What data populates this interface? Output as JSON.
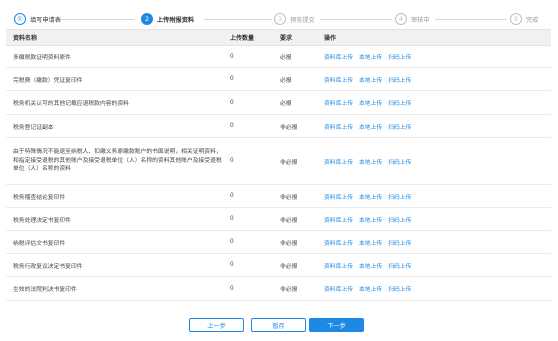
{
  "stepper": {
    "steps": [
      {
        "number": "①",
        "label": "填写申请表",
        "state": "done"
      },
      {
        "number": "2",
        "label": "上传附报资料",
        "state": "active"
      },
      {
        "number": "3",
        "label": "预览提交",
        "state": "todo"
      },
      {
        "number": "4",
        "label": "审核中",
        "state": "todo"
      },
      {
        "number": "5",
        "label": "完成",
        "state": "todo"
      }
    ]
  },
  "table": {
    "headers": {
      "name": "资料名称",
      "count": "上传数量",
      "required": "要求",
      "ops": "操作"
    },
    "rows": [
      {
        "name": "多缴税款证明资料原件",
        "count": "0",
        "required": "必报",
        "ops": [
          "资料库上传",
          "本地上传",
          "扫码上传"
        ]
      },
      {
        "name": "完税费（缴款）凭证复印件",
        "count": "0",
        "required": "必报",
        "ops": [
          "资料库上传",
          "本地上传",
          "扫码上传"
        ]
      },
      {
        "name": "税务机关认可的其他记载应退税款内容的资料",
        "count": "0",
        "required": "必报",
        "ops": [
          "资料库上传",
          "本地上传",
          "扫码上传"
        ]
      },
      {
        "name": "税务登记证副本",
        "count": "0",
        "required": "非必报",
        "ops": [
          "资料库上传",
          "本地上传",
          "扫码上传"
        ]
      },
      {
        "name": "由于特殊情况不能退至纳税人、扣缴义务原缴款账户的书面说明，相关证明资料，和指定接受退税的其他账户及接受退税单位（人）名称的资料其他账户及接受退税单位（人）名称的资料",
        "count": "0",
        "required": "非必报",
        "ops": [
          "资料库上传",
          "本地上传",
          "扫码上传"
        ]
      },
      {
        "name": "税务稽查结论复印件",
        "count": "0",
        "required": "非必报",
        "ops": [
          "资料库上传",
          "本地上传",
          "扫码上传"
        ]
      },
      {
        "name": "税务处理决定书复印件",
        "count": "0",
        "required": "非必报",
        "ops": [
          "资料库上传",
          "本地上传",
          "扫码上传"
        ]
      },
      {
        "name": "纳税评估文书复印件",
        "count": "0",
        "required": "非必报",
        "ops": [
          "资料库上传",
          "本地上传",
          "扫码上传"
        ]
      },
      {
        "name": "税务行政复议决定书复印件",
        "count": "0",
        "required": "非必报",
        "ops": [
          "资料库上传",
          "本地上传",
          "扫码上传"
        ]
      },
      {
        "name": "生效的法院判决书复印件",
        "count": "0",
        "required": "非必报",
        "ops": [
          "资料库上传",
          "本地上传",
          "扫码上传"
        ]
      }
    ]
  },
  "footer": {
    "prev_label": "上一步",
    "save_label": "暂存",
    "next_label": "下一步"
  },
  "colors": {
    "accent": "#1e88e5",
    "header_bg": "#f1f1f1"
  }
}
